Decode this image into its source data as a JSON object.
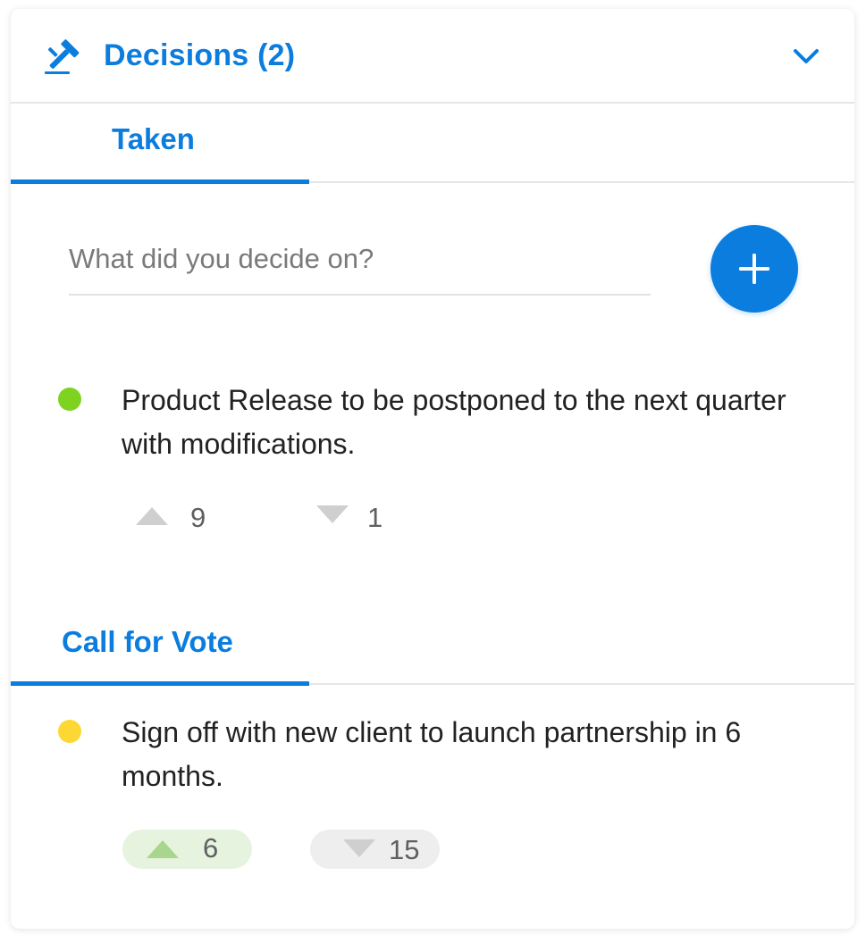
{
  "header": {
    "title": "Decisions (2)",
    "icon": "gavel-icon",
    "toggle_icon": "chevron-down-icon",
    "accent_color": "#0a7ddf"
  },
  "taken": {
    "tab_label": "Taken",
    "input": {
      "placeholder": "What did you decide on?",
      "value": ""
    },
    "add_icon": "plus-icon",
    "items": [
      {
        "text": "Product Release to be postponed to the next quarter with modifications.",
        "status_color": "#7ed321",
        "upvotes": "9",
        "downvotes": "1"
      }
    ]
  },
  "call_for_vote": {
    "tab_label": "Call for Vote",
    "items": [
      {
        "text": "Sign off with new client to launch partnership in 6 months.",
        "status_color": "#fdd835",
        "upvotes": "6",
        "downvotes": "15",
        "upvote_bg": "#e6f3de",
        "downvote_bg": "#eeeeee"
      }
    ]
  }
}
